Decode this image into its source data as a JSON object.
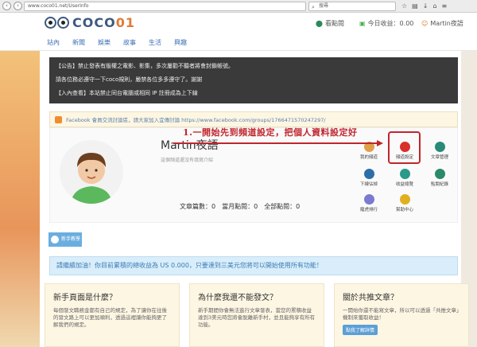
{
  "browser": {
    "url": "www.coco01.net/UserInfo",
    "search_placeholder": "搜尋"
  },
  "logo": {
    "text_main": "COCO",
    "text_accent": "01"
  },
  "header": {
    "checkin": "看點閱",
    "earnings": "今日收益：0.00",
    "username": "Martin夜語"
  },
  "nav": [
    "站內",
    "新聞",
    "娛樂",
    "故事",
    "生活",
    "興趣"
  ],
  "announcements": [
    "【公告】禁止發表有版權之電影、影集，多次屢勸不聽者將會封鎖帳號。",
    "請各位務必遵守一下coco規則，嚴禁各位多多遵守了。謝謝",
    "【入內查看】本站禁止同台電腦或相同 IP 註冊成為上下線"
  ],
  "facebook": "Facebook 會員交流討論區，請大家加入宜傳討論 https://www.facebook.com/groups/1766471570247297/",
  "annotation": "1.一開始先到頻道設定，把個人資料設定好",
  "profile": {
    "name": "Martin夜語",
    "desc": "這個頻道還沒有填寫介紹",
    "stats": [
      "文章篇數：0",
      "當月點閱：0",
      "全部點閱：0"
    ]
  },
  "icons": [
    "我的頻道",
    "頻道設定",
    "文章管理",
    "下線佔掉",
    "收益總覽",
    "點閱紀錄",
    "寵虎排行",
    "幫助中心"
  ],
  "icon_colors": [
    "#e0a04a",
    "#d9302c",
    "#2a8a7a",
    "#2c6fa8",
    "#2a9a8a",
    "#2a8a6a",
    "#7a7ad0",
    "#e0b020"
  ],
  "newbie": "新手教學",
  "info": "請繼續加油！你目前累積的總收益為 US 0.000，只要達到三美元您將可以開始使用所有功能！",
  "cards": [
    {
      "title": "新手頁面是什麼？",
      "body": "每個發文職務金都有自己的規定，為了讓你在往後的發文路上可以更加順利，透過這裡讓你能夠更了解我們的規定。"
    },
    {
      "title": "為什麼我還不能發文？",
      "body": "新手期間你會無法進行文章發表，當您的累積收益達到3美元時您將會脫離新手村，並且能夠享有所有功能。"
    },
    {
      "title": "關於共推文章？",
      "body": "一開始你還不能寫文章，所以可以透過「共推文章」機制來獲取收益！",
      "button": "點我了解詳情"
    }
  ]
}
